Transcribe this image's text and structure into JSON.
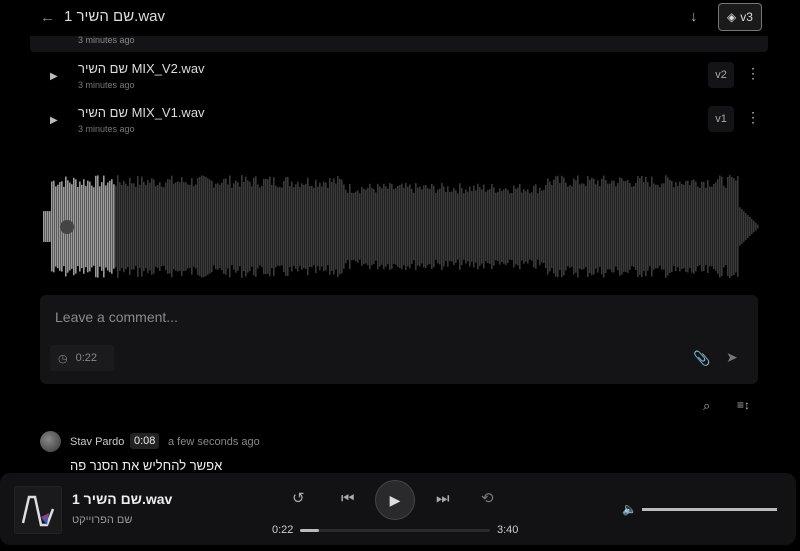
{
  "header": {
    "title": "שם השיר 1.wav",
    "version": "v3"
  },
  "versions": [
    {
      "ago": "3 minutes ago"
    },
    {
      "name": "שם השיר MIX_V2.wav",
      "ago": "3 minutes ago",
      "badge": "v2"
    },
    {
      "name": "שם השיר MIX_V1.wav",
      "ago": "3 minutes ago",
      "badge": "v1"
    }
  ],
  "waveform": {
    "played_fraction": 0.1
  },
  "comment_box": {
    "placeholder": "Leave a comment...",
    "timestamp": "0:22"
  },
  "comments": [
    {
      "author": "Stav Pardo",
      "timestamp": "0:08",
      "ago": "a few seconds ago",
      "text": "אפשר להחליש את הסנר פה"
    }
  ],
  "player": {
    "title": "שם השיר 1.wav",
    "project": "שם הפרוייקט",
    "current": "0:22",
    "total": "3:40",
    "progress": 0.1,
    "volume": 1.0
  },
  "colors": {
    "played": "#9a9a9a",
    "unplayed": "#3a3a3a"
  }
}
